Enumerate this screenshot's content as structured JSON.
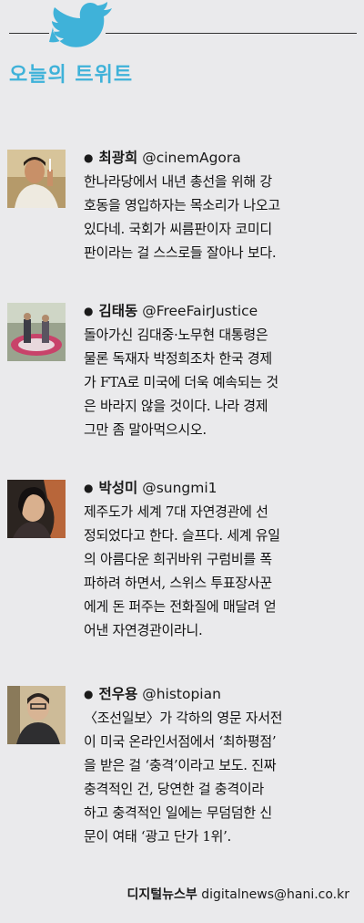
{
  "section": {
    "title": "오늘의 트위트"
  },
  "tweets": [
    {
      "name": "최광희",
      "handle": "@cinemAgora",
      "lines": [
        "한나라당에서 내년 총선을 위해 강",
        "호동을 영입하자는 목소리가 나오고",
        "있다네. 국회가 씨름판이자 코미디",
        "판이라는 걸 스스로들 잘아나 보다."
      ]
    },
    {
      "name": "김태동",
      "handle": "@FreeFairJustice",
      "lines": [
        "돌아가신 김대중·노무현 대통령은",
        "물론 독재자 박정희조차 한국 경제",
        "가 FTA로 미국에 더욱 예속되는 것",
        "은 바라지 않을 것이다. 나라 경제",
        "그만 좀 말아먹으시오."
      ]
    },
    {
      "name": "박성미",
      "handle": "@sungmi1",
      "lines": [
        "제주도가 세계 7대 자연경관에 선",
        "정되었다고 한다. 슬프다. 세계 유일",
        "의 아름다운 희귀바위 구럼비를 폭",
        "파하려 하면서, 스위스 투표장사꾼",
        "에게 돈 퍼주는 전화질에 매달려 얻",
        "어낸 자연경관이라니."
      ]
    },
    {
      "name": "전우용",
      "handle": "@histopian",
      "lines": [
        "〈조선일보〉가 각하의 영문 자서전",
        "이 미국 온라인서점에서 ‘최하평점’",
        "을 받은 걸 ‘충격’이라고 보도. 진짜",
        "충격적인 건, 당연한 걸 충격이라",
        "하고 충격적인 일에는 무덤덤한 신",
        "문이 여태 ‘광고 단가 1위’."
      ]
    }
  ],
  "footer": {
    "desk": "디지털뉴스부",
    "email": "digitalnews@hani.co.kr"
  },
  "colors": {
    "accent": "#3fb2d9",
    "background": "#eaeaec",
    "rule": "#333333"
  }
}
